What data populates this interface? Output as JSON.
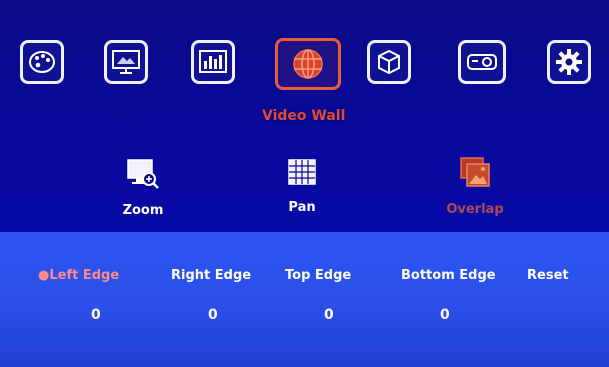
{
  "menu": {
    "icons": [
      {
        "name": "palette-icon"
      },
      {
        "name": "monitor-image-icon"
      },
      {
        "name": "audio-equalizer-icon"
      },
      {
        "name": "globe-grid-icon"
      },
      {
        "name": "cube-icon"
      },
      {
        "name": "projector-icon"
      },
      {
        "name": "gear-icon"
      }
    ],
    "active_title": "Video Wall"
  },
  "submenu": {
    "zoom_label": "Zoom",
    "pan_label": "Pan",
    "overlap_label": "Overlap"
  },
  "settings": {
    "columns": [
      {
        "label": "●Left Edge",
        "value": "0"
      },
      {
        "label": "Right Edge",
        "value": "0"
      },
      {
        "label": "Top Edge",
        "value": "0"
      },
      {
        "label": "Bottom Edge",
        "value": "0"
      },
      {
        "label": "Reset",
        "value": ""
      }
    ]
  },
  "colors": {
    "top_bg": "#0a0b86",
    "bottom_bg": "#2b4fe8",
    "accent": "#e85a3b",
    "selected_text": "#ff8a8a"
  }
}
